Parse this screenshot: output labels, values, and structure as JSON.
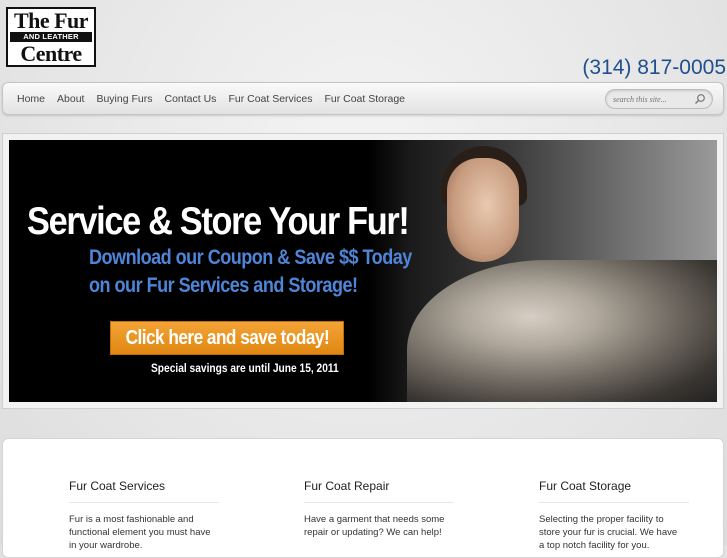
{
  "logo": {
    "line1": "The Fur",
    "line2": "AND LEATHER",
    "line3": "Centre"
  },
  "phone": "(314) 817-0005",
  "nav": [
    "Home",
    "About",
    "Buying Furs",
    "Contact Us",
    "Fur Coat Services",
    "Fur Coat Storage"
  ],
  "search": {
    "placeholder": "search this site...",
    "icon": "search-icon"
  },
  "banner": {
    "headline": "Service & Store Your Fur!",
    "sub1": "Download our Coupon & Save $$ Today",
    "sub2": "on our Fur Services and Storage!",
    "cta": "Click here and save today!",
    "note": "Special savings are until June 15, 2011",
    "colors": {
      "headline": "#ffffff",
      "sub": "#4f85d8",
      "cta": "#e89a25"
    }
  },
  "columns": [
    {
      "title": "Fur Coat Services",
      "text": "Fur is a most fashionable and functional element you must have in your wardrobe."
    },
    {
      "title": "Fur Coat Repair",
      "text": "Have a garment that needs some repair or updating? We can help!"
    },
    {
      "title": "Fur Coat Storage",
      "text": "Selecting the proper facility to store your fur is crucial. We have a top notch facility for you."
    }
  ],
  "colors": {
    "phone": "#1f4f8f",
    "accent": "#e08712"
  }
}
